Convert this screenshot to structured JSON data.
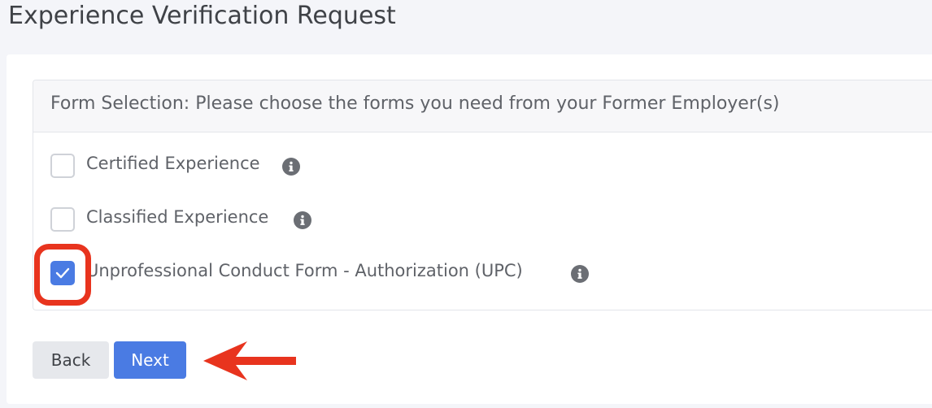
{
  "page": {
    "title": "Experience Verification Request"
  },
  "form_selection": {
    "header": "Form Selection: Please choose the forms you need from your Former Employer(s)",
    "options": [
      {
        "label": "Certified Experience",
        "checked": false,
        "info_icon": "info-circle-icon"
      },
      {
        "label": "Classified Experience",
        "checked": false,
        "info_icon": "info-circle-icon"
      },
      {
        "label": "Unprofessional Conduct Form - Authorization (UPC)",
        "checked": true,
        "info_icon": "info-circle-icon"
      }
    ]
  },
  "buttons": {
    "back_label": "Back",
    "next_label": "Next"
  },
  "annotations": {
    "highlight_color": "#e8341e",
    "arrow_color": "#e8341e",
    "arrow_icon": "left-arrow-icon"
  },
  "colors": {
    "accent": "#4a7be3",
    "secondary_button": "#e6e8ec",
    "text": "#5f6268"
  }
}
